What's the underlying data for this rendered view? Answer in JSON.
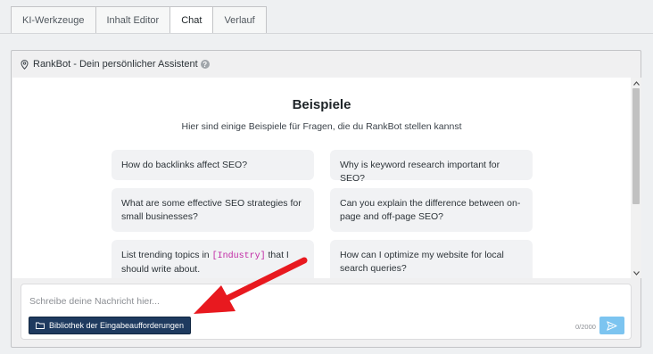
{
  "tabs": [
    {
      "label": "KI-Werkzeuge"
    },
    {
      "label": "Inhalt Editor"
    },
    {
      "label": "Chat",
      "active": true
    },
    {
      "label": "Verlauf"
    }
  ],
  "panel": {
    "title": "RankBot - Dein persönlicher Assistent",
    "help_icon": "question-circle-icon"
  },
  "chat": {
    "heading": "Beispiele",
    "subheading": "Hier sind einige Beispiele für Fragen, die du RankBot stellen kannst",
    "examples": [
      {
        "text": "How do backlinks affect SEO?"
      },
      {
        "text": "Why is keyword research important for SEO?"
      },
      {
        "text": "What are some effective SEO strategies for small businesses?"
      },
      {
        "text": "Can you explain the difference between on-page and off-page SEO?"
      },
      {
        "before": "List trending topics in ",
        "code": "[Industry]",
        "after": " that I should write about."
      },
      {
        "text": "How can I optimize my website for local search queries?"
      }
    ]
  },
  "composer": {
    "placeholder": "Schreibe deine Nachricht hier...",
    "library_button": "Bibliothek der Eingabeaufforderungen",
    "counter": "0/2000",
    "send_icon": "send-icon"
  },
  "colors": {
    "accent_dark": "#1e3a5f",
    "send_button": "#7cc4f0",
    "annotation_arrow": "#e8191f",
    "code_text": "#c026a3"
  }
}
